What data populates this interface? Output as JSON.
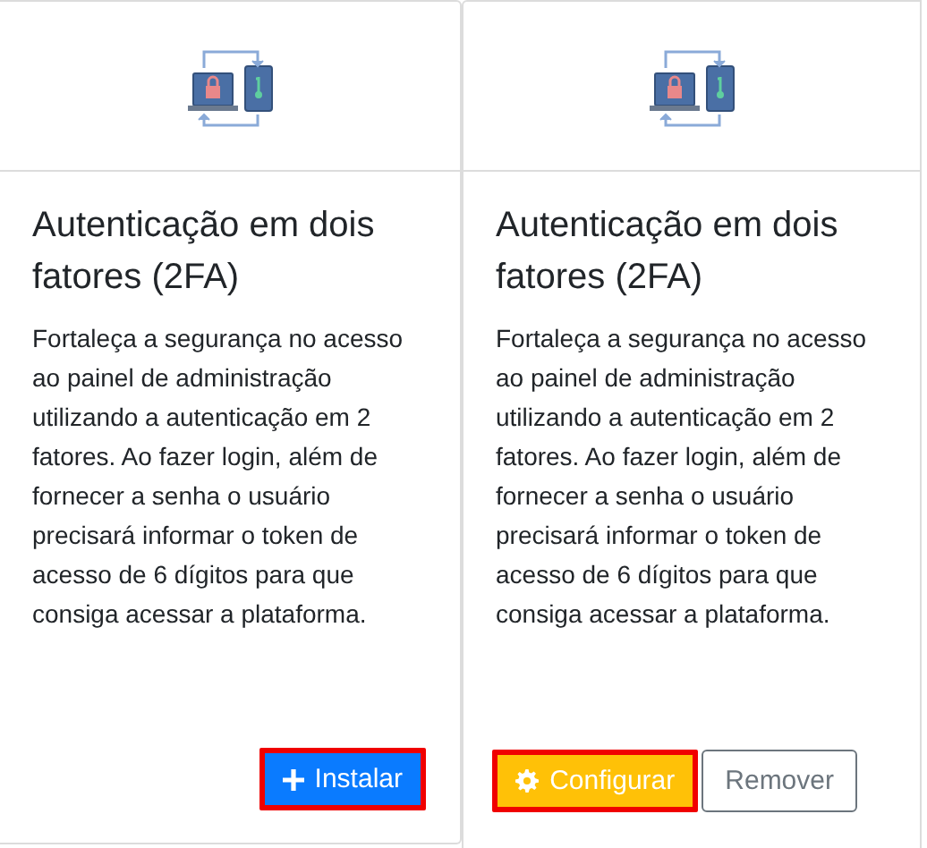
{
  "cards": [
    {
      "title": "Autenticação em dois fatores (2FA)",
      "description": "Fortaleça a segurança no acesso ao painel de administração utilizando a autenticação em 2 fatores. Ao fazer login, além de fornecer a senha o usuário precisará informar o token de acesso de 6 dígitos para que consiga acessar a plataforma.",
      "buttons": [
        {
          "kind": "install",
          "label": "Instalar",
          "highlighted": true
        }
      ]
    },
    {
      "title": "Autenticação em dois fatores (2FA)",
      "description": "Fortaleça a segurança no acesso ao painel de administração utilizando a autenticação em 2 fatores. Ao fazer login, além de fornecer a senha o usuário precisará informar o token de acesso de 6 dígitos para que consiga acessar a plataforma.",
      "buttons": [
        {
          "kind": "configure",
          "label": "Configurar",
          "highlighted": true
        },
        {
          "kind": "remove",
          "label": "Remover",
          "highlighted": false
        }
      ]
    }
  ]
}
